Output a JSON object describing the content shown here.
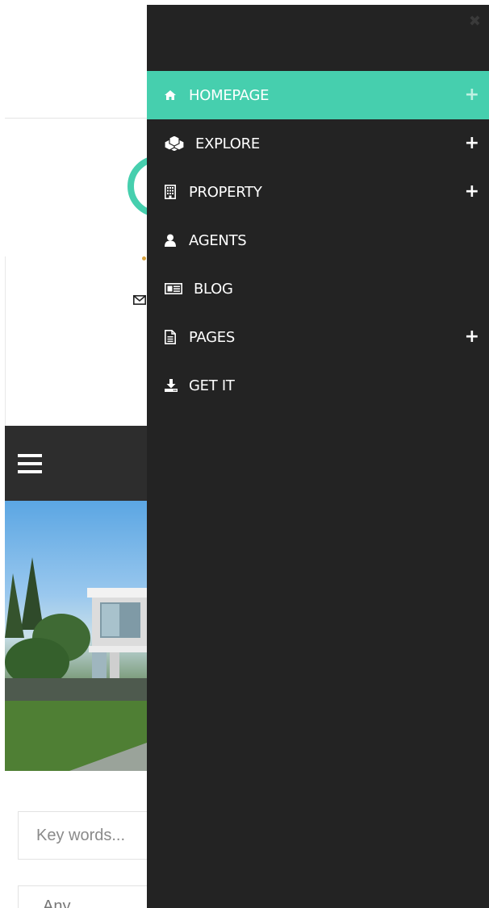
{
  "colors": {
    "accent": "#46cfae",
    "drawer_bg": "#232323",
    "navbar_bg": "#2d2d2d",
    "menu_text": "#ffffff"
  },
  "drawer": {
    "close_icon": "close-icon",
    "menu": [
      {
        "label": "HOMEPAGE",
        "icon": "home-icon",
        "active": true,
        "expandable": true
      },
      {
        "label": "EXPLORE",
        "icon": "cubes-icon",
        "active": false,
        "expandable": true
      },
      {
        "label": "PROPERTY",
        "icon": "building-icon",
        "active": false,
        "expandable": true
      },
      {
        "label": "AGENTS",
        "icon": "user-icon",
        "active": false,
        "expandable": false
      },
      {
        "label": "BLOG",
        "icon": "newspaper-icon",
        "active": false,
        "expandable": false
      },
      {
        "label": "PAGES",
        "icon": "file-icon",
        "active": false,
        "expandable": true
      },
      {
        "label": "GET IT",
        "icon": "download-icon",
        "active": false,
        "expandable": false
      }
    ],
    "expand_symbol": "+"
  },
  "background_page": {
    "hamburger_icon": "hamburger-menu-icon",
    "search": {
      "placeholder": "Key words..."
    },
    "type_select": {
      "value": "Any"
    }
  }
}
